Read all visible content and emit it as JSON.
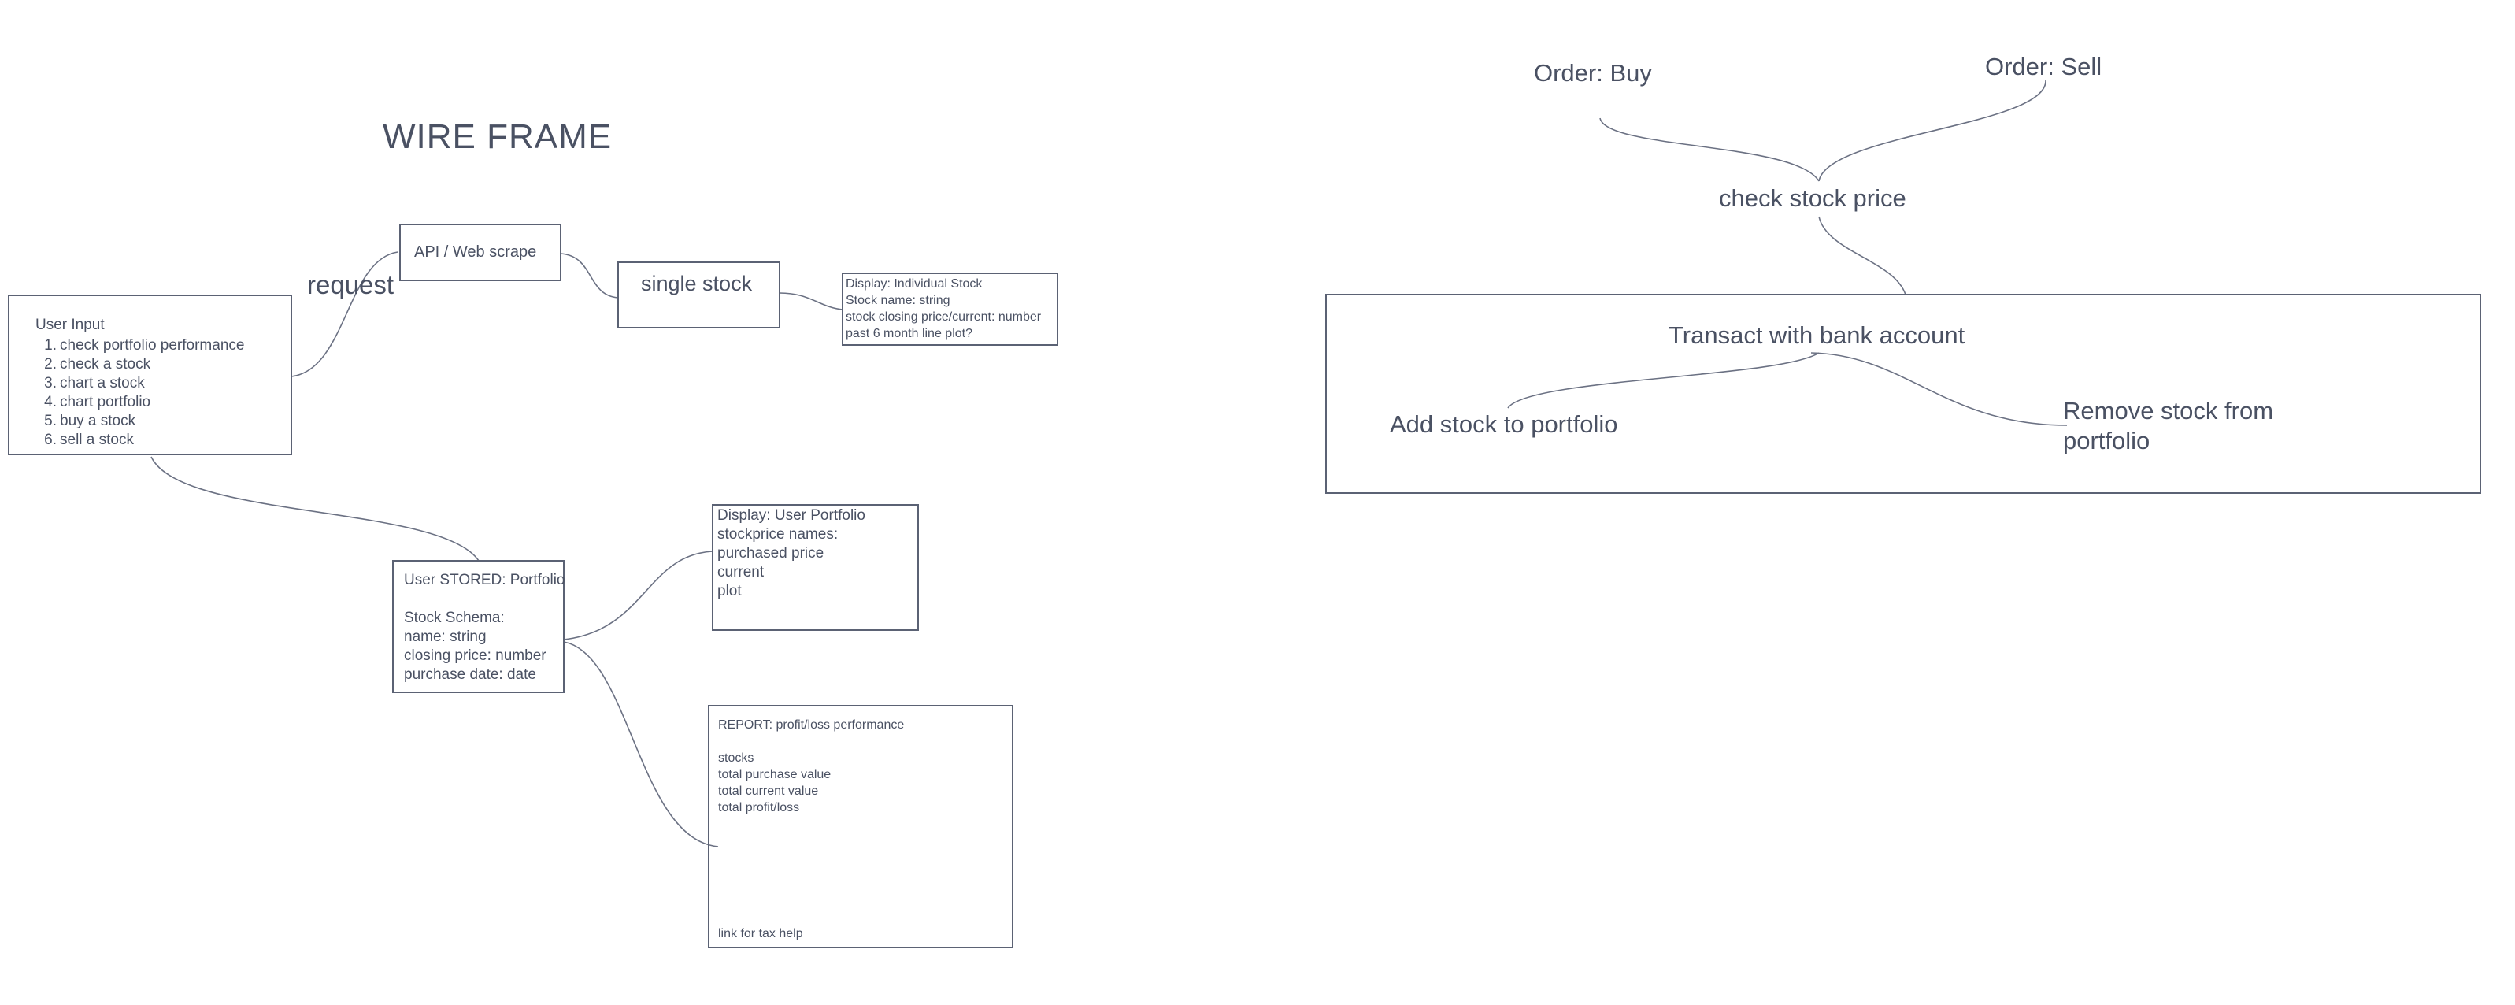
{
  "wireframe": {
    "title": "WIRE FRAME",
    "request_label": "request",
    "api_box": "API / Web scrape",
    "single_stock_box": "single stock",
    "display_individual": {
      "lines": [
        "Display: Individual Stock",
        "Stock name: string",
        "stock closing price/current: number",
        "past 6 month line plot?"
      ]
    },
    "user_input": {
      "title": "User Input",
      "items": [
        {
          "num": "1.",
          "label": "check portfolio performance"
        },
        {
          "num": "2.",
          "label": "check a stock"
        },
        {
          "num": "3.",
          "label": "chart a stock"
        },
        {
          "num": "4.",
          "label": "chart portfolio"
        },
        {
          "num": "5.",
          "label": "buy a stock"
        },
        {
          "num": "6.",
          "label": "sell a stock"
        }
      ]
    },
    "user_stored": {
      "lines": [
        "User STORED: Portfolio",
        "",
        "Stock Schema:",
        "name: string",
        "closing price: number",
        "purchase date: date"
      ]
    },
    "display_portfolio": {
      "lines": [
        "Display: User Portfolio",
        "stockprice names:",
        "purchased price",
        "current",
        "plot"
      ]
    },
    "report": {
      "lines": [
        "REPORT: profit/loss performance",
        "",
        "stocks",
        "total purchase value",
        "total current value",
        "total profit/loss"
      ],
      "footer": "link for tax help"
    }
  },
  "order_flow": {
    "order_buy": "Order: Buy",
    "order_sell": "Order: Sell",
    "check_price": "check stock price",
    "transact": "Transact with bank account",
    "add_stock": "Add stock to portfolio",
    "remove_stock_line1": "Remove stock from",
    "remove_stock_line2": "portfolio"
  }
}
